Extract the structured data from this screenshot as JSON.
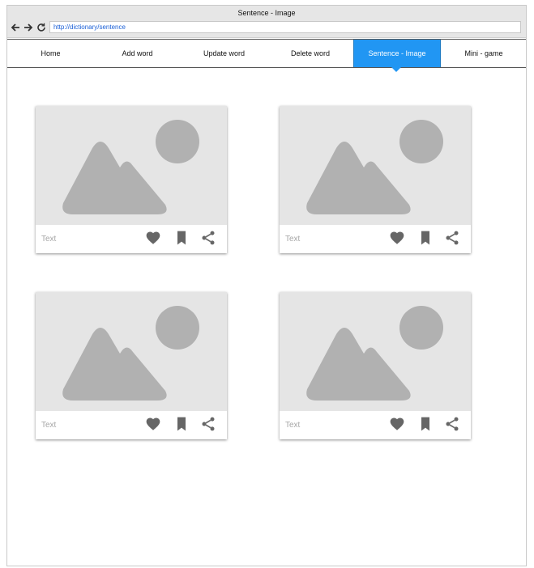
{
  "window": {
    "title": "Sentence - Image",
    "url": "http://dictionary/sentence"
  },
  "nav": {
    "back_icon": "arrow-left-icon",
    "forward_icon": "arrow-right-icon",
    "reload_icon": "reload-icon"
  },
  "tabs": [
    {
      "label": "Home",
      "active": false
    },
    {
      "label": "Add word",
      "active": false
    },
    {
      "label": "Update word",
      "active": false
    },
    {
      "label": "Delete word",
      "active": false
    },
    {
      "label": "Sentence - Image",
      "active": true
    },
    {
      "label": "Mini - game",
      "active": false
    }
  ],
  "colors": {
    "accent": "#2196f3",
    "placeholder_bg": "#e5e5e5",
    "placeholder_shape": "#b1b1b1",
    "icon": "#666666"
  },
  "cards": [
    {
      "text": "Text",
      "icons": [
        "heart-icon",
        "bookmark-icon",
        "share-icon"
      ]
    },
    {
      "text": "Text",
      "icons": [
        "heart-icon",
        "bookmark-icon",
        "share-icon"
      ]
    },
    {
      "text": "Text",
      "icons": [
        "heart-icon",
        "bookmark-icon",
        "share-icon"
      ]
    },
    {
      "text": "Text",
      "icons": [
        "heart-icon",
        "bookmark-icon",
        "share-icon"
      ]
    }
  ]
}
